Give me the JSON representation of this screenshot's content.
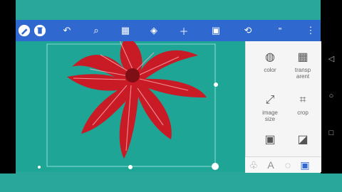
{
  "toolbar": {
    "icons": [
      "pencil-icon",
      "trash-icon",
      "undo-icon",
      "zoom-icon",
      "grid-icon",
      "layers-icon",
      "add-icon",
      "save-icon",
      "share-icon",
      "quote-icon",
      "more-icon"
    ]
  },
  "side_panel": {
    "items": [
      {
        "label": "color"
      },
      {
        "label": "transp\narent"
      },
      {
        "label": "image\nsize"
      },
      {
        "label": "crop"
      },
      {
        "label": ""
      },
      {
        "label": ""
      }
    ]
  },
  "colors": {
    "toolbar": "#2f68cf",
    "canvas": "#1fa596",
    "flower": "#c91b25"
  }
}
